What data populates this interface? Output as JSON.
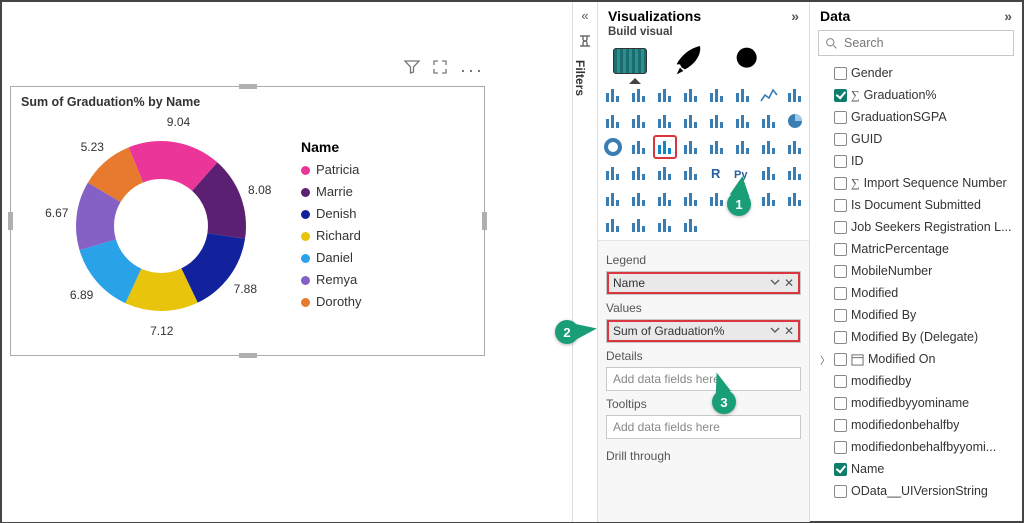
{
  "canvas": {
    "tile_title": "Sum of Graduation% by Name"
  },
  "chart_data": {
    "type": "pie",
    "title": "Sum of Graduation% by Name",
    "hole": 0.55,
    "legend_title": "Name",
    "series": [
      {
        "name": "Patricia",
        "value": 9.04,
        "color": "#ec3598"
      },
      {
        "name": "Marrie",
        "value": 8.08,
        "color": "#5b2071"
      },
      {
        "name": "Denish",
        "value": 7.88,
        "color": "#12229d"
      },
      {
        "name": "Richard",
        "value": 7.12,
        "color": "#e8c40c"
      },
      {
        "name": "Daniel",
        "value": 6.89,
        "color": "#2aa2e8"
      },
      {
        "name": "Remya",
        "value": 6.67,
        "color": "#8661c5"
      },
      {
        "name": "Dorothy",
        "value": 5.23,
        "color": "#e77a2f"
      }
    ]
  },
  "filters_rail": {
    "label": "Filters"
  },
  "viz": {
    "title": "Visualizations",
    "subtitle": "Build visual",
    "wells": {
      "legend_label": "Legend",
      "legend_value": "Name",
      "values_label": "Values",
      "values_value": "Sum of Graduation%",
      "details_label": "Details",
      "details_placeholder": "Add data fields here",
      "tooltips_label": "Tooltips",
      "tooltips_placeholder": "Add data fields here",
      "drill_label": "Drill through"
    }
  },
  "data": {
    "title": "Data",
    "search_placeholder": "Search",
    "fields": [
      {
        "label": "Gender",
        "checked": false
      },
      {
        "label": "Graduation%",
        "checked": true,
        "sigma": true
      },
      {
        "label": "GraduationSGPA",
        "checked": false
      },
      {
        "label": "GUID",
        "checked": false
      },
      {
        "label": "ID",
        "checked": false
      },
      {
        "label": "Import Sequence Number",
        "checked": false,
        "sigma": true
      },
      {
        "label": "Is Document Submitted",
        "checked": false
      },
      {
        "label": "Job Seekers Registration L...",
        "checked": false
      },
      {
        "label": "MatricPercentage",
        "checked": false
      },
      {
        "label": "MobileNumber",
        "checked": false
      },
      {
        "label": "Modified",
        "checked": false
      },
      {
        "label": "Modified By",
        "checked": false
      },
      {
        "label": "Modified By (Delegate)",
        "checked": false
      },
      {
        "label": "Modified On",
        "checked": false,
        "expandable": true,
        "calendar": true
      },
      {
        "label": "modifiedby",
        "checked": false
      },
      {
        "label": "modifiedbyyominame",
        "checked": false
      },
      {
        "label": "modifiedonbehalfby",
        "checked": false
      },
      {
        "label": "modifiedonbehalfbyyomi...",
        "checked": false
      },
      {
        "label": "Name",
        "checked": true
      },
      {
        "label": "OData__UIVersionString",
        "checked": false
      }
    ]
  },
  "annotations": {
    "one": "1",
    "two": "2",
    "three": "3"
  }
}
